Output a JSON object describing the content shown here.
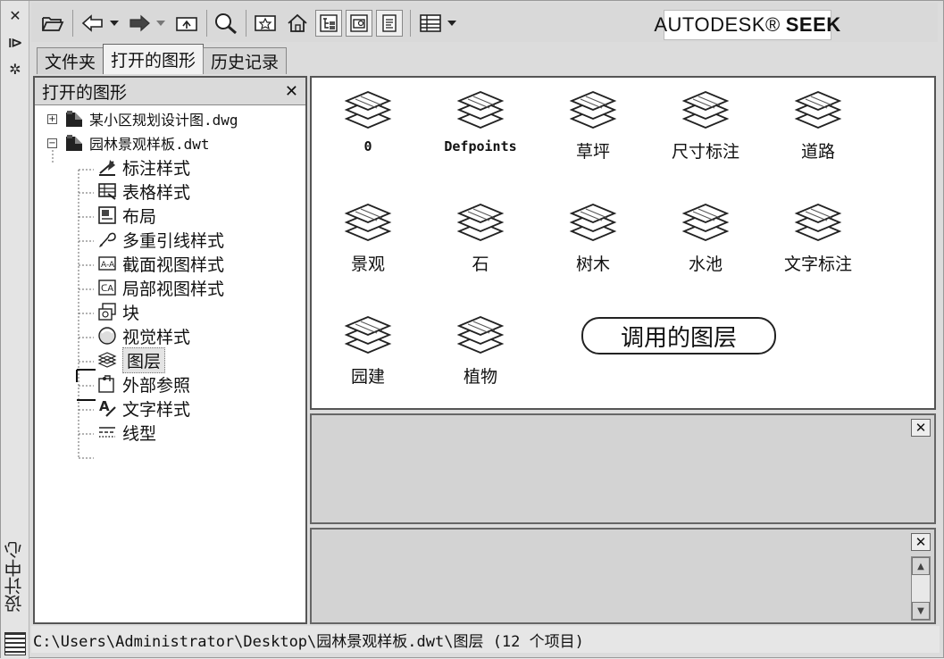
{
  "left_strip": {
    "close_glyph": "✕",
    "autohide_glyph": "⧐",
    "properties_glyph": "✲",
    "title": "设计中心"
  },
  "toolbar": {
    "seek_brand": "AUTODESK®",
    "seek_word": "SEEK"
  },
  "tabs": [
    {
      "label": "文件夹",
      "active": false
    },
    {
      "label": "打开的图形",
      "active": true
    },
    {
      "label": "历史记录",
      "active": false
    }
  ],
  "tree": {
    "header": "打开的图形",
    "close_glyph": "✕",
    "drawings": [
      {
        "expander": "+",
        "name": "某小区规划设计图.dwg"
      },
      {
        "expander": "−",
        "name": "园林景观样板.dwt"
      }
    ],
    "children": [
      {
        "label": "标注样式",
        "icon": "dimstyle-icon"
      },
      {
        "label": "表格样式",
        "icon": "tablestyle-icon"
      },
      {
        "label": "布局",
        "icon": "layout-icon"
      },
      {
        "label": "多重引线样式",
        "icon": "mleaderstyle-icon"
      },
      {
        "label": "截面视图样式",
        "icon": "sectionview-icon"
      },
      {
        "label": "局部视图样式",
        "icon": "detailview-icon"
      },
      {
        "label": "块",
        "icon": "block-icon"
      },
      {
        "label": "视觉样式",
        "icon": "visualstyle-icon"
      },
      {
        "label": "图层",
        "icon": "layers-icon",
        "selected": true
      },
      {
        "label": "外部参照",
        "icon": "xref-icon"
      },
      {
        "label": "文字样式",
        "icon": "textstyle-icon"
      },
      {
        "label": "线型",
        "icon": "linetype-icon"
      }
    ]
  },
  "layers": [
    {
      "name": "0"
    },
    {
      "name": "Defpoints"
    },
    {
      "name": "草坪"
    },
    {
      "name": "尺寸标注"
    },
    {
      "name": "道路"
    },
    {
      "name": "景观"
    },
    {
      "name": "石"
    },
    {
      "name": "树木"
    },
    {
      "name": "水池"
    },
    {
      "name": "文字标注"
    },
    {
      "name": "园建"
    },
    {
      "name": "植物"
    }
  ],
  "callout": "调用的图层",
  "preview": {
    "close_glyph": "✕"
  },
  "description": {
    "close_glyph": "✕"
  },
  "status": {
    "path": "C:\\Users\\Administrator\\Desktop\\园林景观样板.dwt\\图层 (12 个项目)"
  }
}
